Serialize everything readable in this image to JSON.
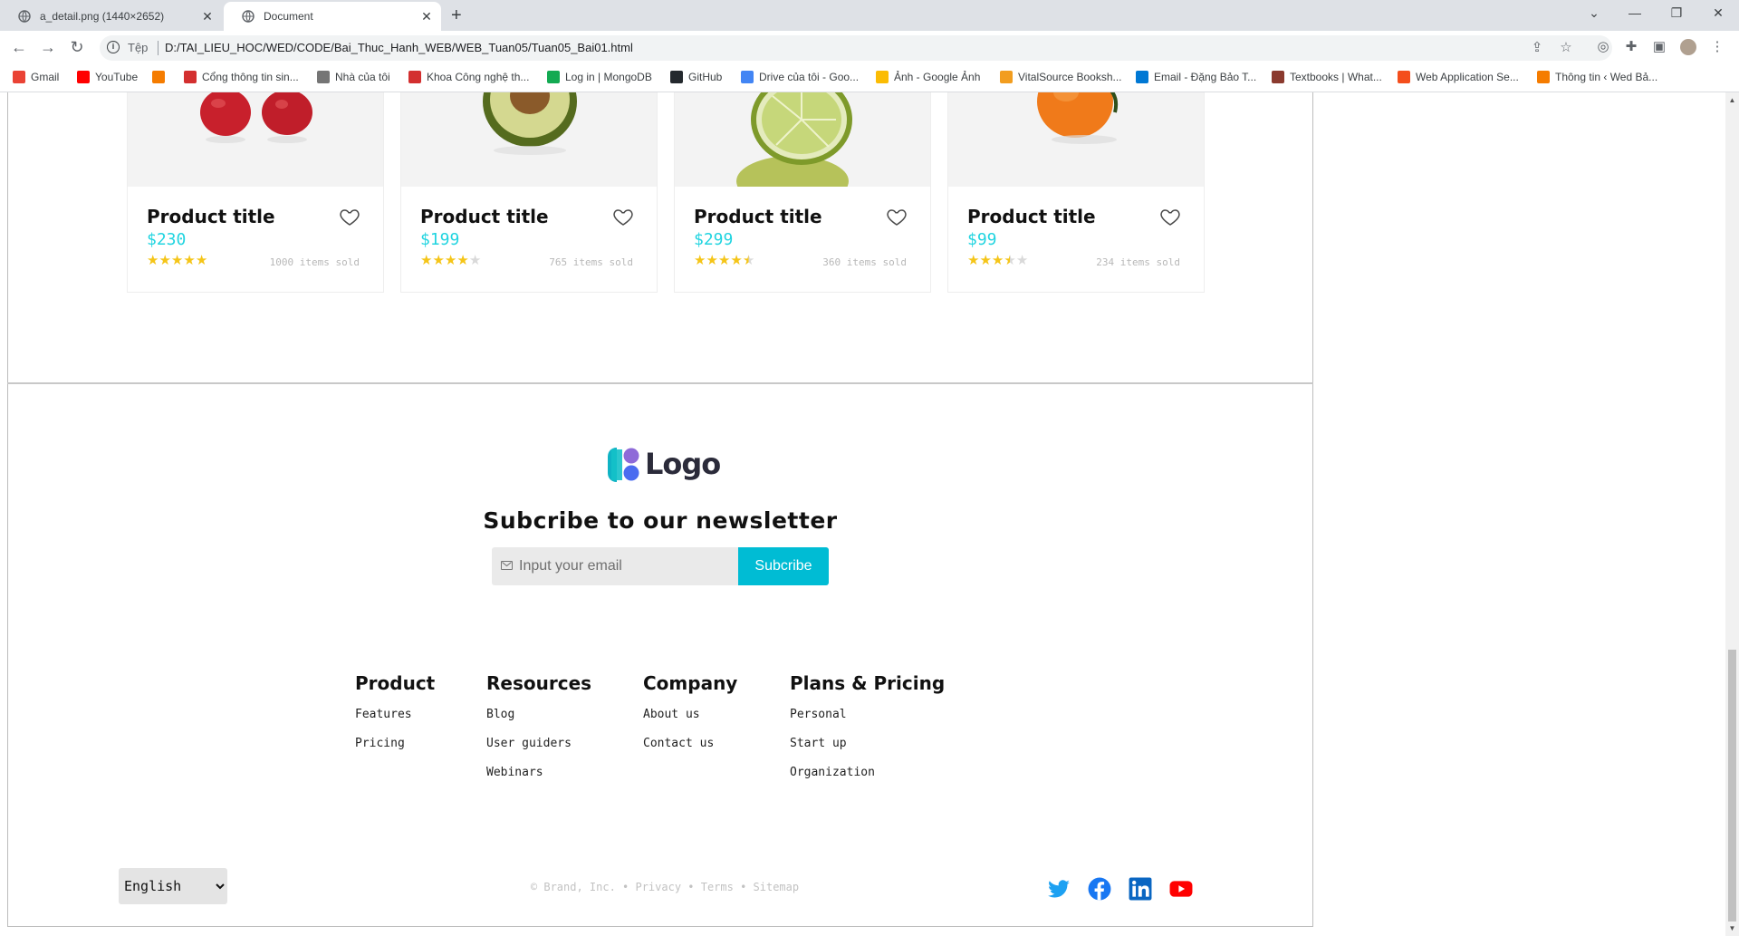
{
  "browser": {
    "tabs": [
      {
        "title": "a_detail.png (1440×2652)",
        "active": false
      },
      {
        "title": "Document",
        "active": true
      }
    ],
    "address": {
      "scheme": "Tệp",
      "url": "D:/TAI_LIEU_HOC/WED/CODE/Bai_Thuc_Hanh_WEB/WEB_Tuan05/Tuan05_Bai01.html"
    },
    "bookmarks": [
      {
        "label": "Gmail",
        "icon": "gmail-icon",
        "color": "#EA4335"
      },
      {
        "label": "YouTube",
        "icon": "youtube-icon",
        "color": "#FF0000"
      },
      {
        "label": "",
        "icon": "portal-icon",
        "color": "#F57C00"
      },
      {
        "label": "Cổng thông tin sin...",
        "icon": "school-icon",
        "color": "#D32F2F"
      },
      {
        "label": "Nhà của tôi",
        "icon": "home-icon",
        "color": "#757575"
      },
      {
        "label": "Khoa Công nghệ th...",
        "icon": "school-icon",
        "color": "#D32F2F"
      },
      {
        "label": "Log in | MongoDB",
        "icon": "mongodb-icon",
        "color": "#13AA52"
      },
      {
        "label": "GitHub",
        "icon": "github-icon",
        "color": "#24292E"
      },
      {
        "label": "Drive của tôi - Goo...",
        "icon": "docs-icon",
        "color": "#4285F4"
      },
      {
        "label": "Ảnh - Google Ảnh",
        "icon": "photos-icon",
        "color": "#FBBC04"
      },
      {
        "label": "VitalSource Booksh...",
        "icon": "vitalsource-icon",
        "color": "#F29D1F"
      },
      {
        "label": "Email - Đặng Bảo T...",
        "icon": "outlook-icon",
        "color": "#0078D4"
      },
      {
        "label": "Textbooks | What...",
        "icon": "textbooks-icon",
        "color": "#8B3A2E"
      },
      {
        "label": "Web Application Se...",
        "icon": "webapp-icon",
        "color": "#F44E1C"
      },
      {
        "label": "Thông tin ‹ Wed Bả...",
        "icon": "portal-icon",
        "color": "#F57C00"
      }
    ]
  },
  "products": [
    {
      "title": "Product title",
      "price": "$230",
      "rating": 5,
      "sold": "1000 items sold",
      "image": "apples"
    },
    {
      "title": "Product title",
      "price": "$199",
      "rating": 4,
      "sold": "765 items sold",
      "image": "avocado"
    },
    {
      "title": "Product title",
      "price": "$299",
      "rating": 4.5,
      "sold": "360 items sold",
      "image": "lime"
    },
    {
      "title": "Product title",
      "price": "$99",
      "rating": 3.5,
      "sold": "234 items sold",
      "image": "orange"
    }
  ],
  "footer": {
    "logo_text": "Logo",
    "newsletter_title": "Subcribe to our newsletter",
    "email_placeholder": "Input your email",
    "subscribe_label": "Subcribe",
    "columns": [
      {
        "title": "Product",
        "links": [
          "Features",
          "Pricing"
        ]
      },
      {
        "title": "Resources",
        "links": [
          "Blog",
          "User guiders",
          "Webinars"
        ]
      },
      {
        "title": "Company",
        "links": [
          "About us",
          "Contact us"
        ]
      },
      {
        "title": "Plans & Pricing",
        "links": [
          "Personal",
          "Start up",
          "Organization"
        ]
      }
    ],
    "language": "English",
    "copyright": "© Brand, Inc. • Privacy • Terms • Sitemap",
    "social": [
      "twitter-icon",
      "facebook-icon",
      "linkedin-icon",
      "youtube-icon"
    ]
  },
  "colors": {
    "accent": "#00BCD4",
    "price": "#21D4E0",
    "star": "#F5C518"
  }
}
